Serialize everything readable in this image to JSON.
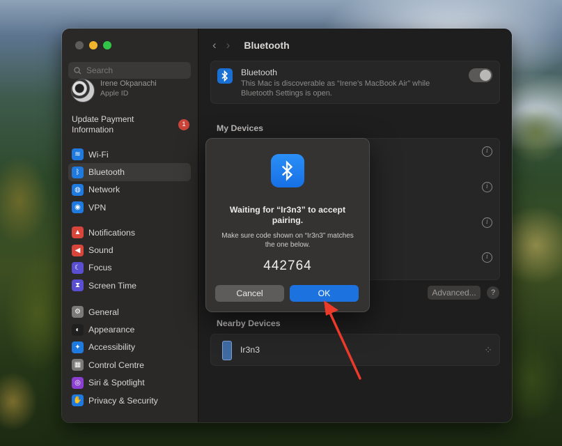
{
  "sidebar": {
    "search_placeholder": "Search",
    "profile": {
      "name": "Irene Okpanachi",
      "sub": "Apple ID"
    },
    "update": {
      "label": "Update Payment Information",
      "badge": "1"
    },
    "groups": [
      [
        {
          "label": "Wi-Fi",
          "icon": "wifi-icon",
          "color": "#1f7ae0",
          "glyph": "≋"
        },
        {
          "label": "Bluetooth",
          "icon": "bluetooth-icon",
          "color": "#1f7ae0",
          "glyph": "ᛒ",
          "active": true
        },
        {
          "label": "Network",
          "icon": "globe-icon",
          "color": "#1f7ae0",
          "glyph": "◍"
        },
        {
          "label": "VPN",
          "icon": "vpn-icon",
          "color": "#1f7ae0",
          "glyph": "◉"
        }
      ],
      [
        {
          "label": "Notifications",
          "icon": "bell-icon",
          "color": "#d8453b",
          "glyph": "▲"
        },
        {
          "label": "Sound",
          "icon": "speaker-icon",
          "color": "#d8453b",
          "glyph": "◀"
        },
        {
          "label": "Focus",
          "icon": "moon-icon",
          "color": "#5a4fd0",
          "glyph": "☾"
        },
        {
          "label": "Screen Time",
          "icon": "hourglass-icon",
          "color": "#5a4fd0",
          "glyph": "⧗"
        }
      ],
      [
        {
          "label": "General",
          "icon": "gear-icon",
          "color": "#7c7a79",
          "glyph": "⚙"
        },
        {
          "label": "Appearance",
          "icon": "appearance-icon",
          "color": "#202020",
          "glyph": "◐"
        },
        {
          "label": "Accessibility",
          "icon": "accessibility-icon",
          "color": "#1f7ae0",
          "glyph": "✦"
        },
        {
          "label": "Control Centre",
          "icon": "control-centre-icon",
          "color": "#7c7a79",
          "glyph": "▦"
        },
        {
          "label": "Siri & Spotlight",
          "icon": "siri-icon",
          "color": "#8a3fd0",
          "glyph": "◎"
        },
        {
          "label": "Privacy & Security",
          "icon": "hand-icon",
          "color": "#1f7ae0",
          "glyph": "✋"
        }
      ]
    ]
  },
  "toolbar": {
    "back": "‹",
    "forward": "›",
    "title": "Bluetooth"
  },
  "bluetooth": {
    "title": "Bluetooth",
    "description": "This Mac is discoverable as “Irene’s MacBook Air” while Bluetooth Settings is open."
  },
  "my_devices": {
    "heading": "My Devices",
    "info_glyph": "i"
  },
  "buttons": {
    "advanced": "Advanced...",
    "help": "?"
  },
  "nearby": {
    "heading": "Nearby Devices",
    "device": "Ir3n3",
    "spinner": "⁘"
  },
  "dialog": {
    "title": "Waiting for “Ir3n3” to accept pairing.",
    "message": "Make sure code shown on “Ir3n3” matches the one below.",
    "code": "442764",
    "cancel": "Cancel",
    "ok": "OK"
  }
}
